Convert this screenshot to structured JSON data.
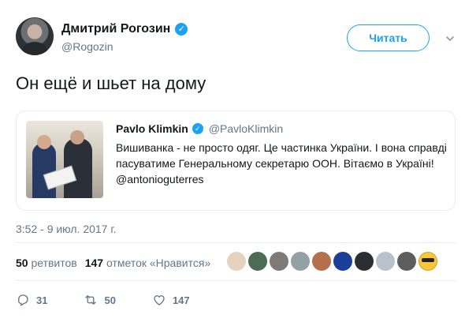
{
  "author": {
    "display_name": "Дмитрий Рогозин",
    "handle": "@Rogozin",
    "verified_icon": "verified-check-icon",
    "avatar_icon": "profile-avatar"
  },
  "follow_button": {
    "label": "Читать"
  },
  "more_icon": "chevron-down-icon",
  "tweet": {
    "text": "Он ещё и шьет на дому"
  },
  "quoted": {
    "display_name": "Pavlo Klimkin",
    "handle": "@PavloKlimkin",
    "text": "Вишиванка - не просто одяг. Це частинка України. І вона справді пасуватиме Генеральному секретарю ООН. Вітаємо в Україні! @antonioguterres"
  },
  "timestamp": "3:52 - 9 июл. 2017 г.",
  "stats": {
    "retweets_count": "50",
    "retweets_label": "ретвитов",
    "likes_count": "147",
    "likes_label": "отметок «Нравится»"
  },
  "likers": [
    {
      "icon": "cartoon-avatar",
      "color": "#e5d3bf"
    },
    {
      "icon": "portrait-avatar",
      "color": "#4d6b55"
    },
    {
      "icon": "animal-avatar",
      "color": "#7d7a78"
    },
    {
      "icon": "landscape-avatar",
      "color": "#93a1a4"
    },
    {
      "icon": "photo-avatar",
      "color": "#b56f4d"
    },
    {
      "icon": "flag-avatar",
      "color": "#1b3e9b"
    },
    {
      "icon": "dark-avatar",
      "color": "#2d2e34"
    },
    {
      "icon": "default-avatar",
      "color": "#b8c2cb"
    },
    {
      "icon": "mono-avatar",
      "color": "#5d5d5d"
    },
    {
      "icon": "sunglasses-emoji-avatar",
      "color": "#f6c73b"
    }
  ],
  "actions": {
    "reply": {
      "icon": "reply-icon",
      "count": "31"
    },
    "retweet": {
      "icon": "retweet-icon",
      "count": "50"
    },
    "like": {
      "icon": "heart-icon",
      "count": "147"
    }
  },
  "colors": {
    "accent": "#1da1f2",
    "muted": "#657786",
    "text": "#14171a",
    "border": "#e6ecf0"
  }
}
